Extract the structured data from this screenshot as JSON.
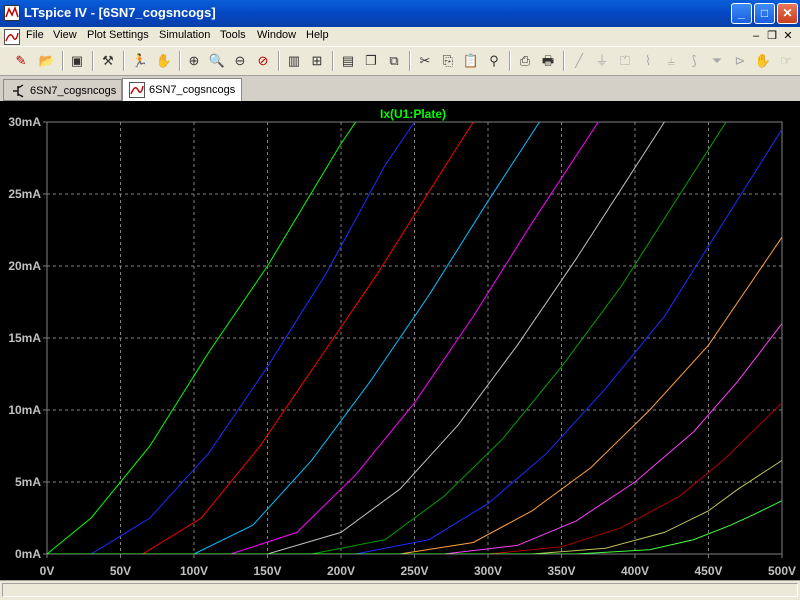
{
  "window": {
    "title": "LTspice IV - [6SN7_cogsncogs]",
    "controls": {
      "minimize": "_",
      "maximize": "□",
      "close": "✕"
    }
  },
  "menu": {
    "items": [
      "File",
      "View",
      "Plot Settings",
      "Simulation",
      "Tools",
      "Window",
      "Help"
    ],
    "mdi_controls": {
      "minimize": "–",
      "restore": "❐",
      "close": "✕"
    }
  },
  "toolbar": {
    "icons": [
      "new-schematic-icon",
      "open-icon",
      "save-icon",
      "control-panel-icon",
      "run-icon",
      "halt-icon",
      "zoom-in-icon",
      "zoom-area-icon",
      "zoom-out-icon",
      "zoom-cancel-icon",
      "autorange-icon",
      "zoom-extents-icon",
      "tile-icon",
      "cascade-icon",
      "close-windows-icon",
      "cut-icon",
      "copy-icon",
      "paste-icon",
      "find-icon",
      "print-setup-icon",
      "print-icon",
      "wire-icon",
      "ground-icon",
      "label-icon",
      "resistor-icon",
      "capacitor-icon",
      "inductor-icon",
      "diode-icon",
      "component-icon",
      "move-icon",
      "drag-icon"
    ]
  },
  "tabs": [
    {
      "label": "6SN7_cogsncogs",
      "icon": "schematic-icon",
      "active": false
    },
    {
      "label": "6SN7_cogsncogs",
      "icon": "waveform-icon",
      "active": true
    }
  ],
  "plot": {
    "trace_label": "Ix(U1:Plate)",
    "trace_label_color": "#00ff00",
    "grid_color": "#808080",
    "axis_text_color": "#c0c0c0"
  },
  "chart_data": {
    "type": "line",
    "title": "Ix(U1:Plate)",
    "xlabel": "",
    "ylabel": "",
    "xlim": [
      0,
      500
    ],
    "ylim": [
      0,
      30
    ],
    "x_ticks": [
      "0V",
      "50V",
      "100V",
      "150V",
      "200V",
      "250V",
      "300V",
      "350V",
      "400V",
      "450V",
      "500V"
    ],
    "y_ticks": [
      "0mA",
      "5mA",
      "10mA",
      "15mA",
      "20mA",
      "25mA",
      "30mA"
    ],
    "grid": true,
    "legend": "none",
    "series": [
      {
        "color": "#00ff00",
        "x": [
          0,
          30,
          70,
          110,
          150,
          200,
          210
        ],
        "y": [
          0,
          2.5,
          7.5,
          14,
          20,
          28.5,
          30
        ]
      },
      {
        "color": "#1c2cff",
        "x": [
          30,
          70,
          110,
          150,
          190,
          230,
          250
        ],
        "y": [
          0,
          2.5,
          7,
          13,
          19.5,
          27,
          30
        ]
      },
      {
        "color": "#ff0000",
        "x": [
          65,
          105,
          145,
          185,
          225,
          265,
          290
        ],
        "y": [
          0,
          2.5,
          7.5,
          13.5,
          19.5,
          26,
          30
        ]
      },
      {
        "color": "#00c0ff",
        "x": [
          100,
          140,
          180,
          220,
          260,
          300,
          335
        ],
        "y": [
          0,
          2,
          6.5,
          12,
          18,
          24.5,
          30
        ]
      },
      {
        "color": "#ff00ff",
        "x": [
          125,
          170,
          210,
          250,
          290,
          330,
          375
        ],
        "y": [
          0,
          1.5,
          5.5,
          10.5,
          16.5,
          23,
          30
        ]
      },
      {
        "color": "#c0c0c0",
        "x": [
          150,
          200,
          240,
          280,
          320,
          360,
          420
        ],
        "y": [
          0,
          1.5,
          4.5,
          9,
          14.5,
          20.5,
          30
        ]
      },
      {
        "color": "#00a000",
        "x": [
          180,
          230,
          270,
          310,
          350,
          390,
          462
        ],
        "y": [
          0,
          1,
          4,
          8,
          13,
          18.5,
          30
        ]
      },
      {
        "color": "#1c2cff",
        "x": [
          210,
          260,
          300,
          340,
          380,
          420,
          500
        ],
        "y": [
          0,
          1,
          3.5,
          7,
          11.5,
          16.5,
          29.5
        ]
      },
      {
        "color": "#ffa040",
        "x": [
          240,
          290,
          330,
          370,
          410,
          450,
          500
        ],
        "y": [
          0,
          0.8,
          3,
          6,
          10,
          14.5,
          22
        ]
      },
      {
        "color": "#ff40ff",
        "x": [
          270,
          320,
          360,
          400,
          440,
          470,
          500
        ],
        "y": [
          0,
          0.6,
          2.3,
          5,
          8.5,
          12,
          16
        ]
      },
      {
        "color": "#b00000",
        "x": [
          300,
          350,
          390,
          430,
          460,
          480,
          500
        ],
        "y": [
          0,
          0.5,
          1.8,
          4,
          6.5,
          8.5,
          10.5
        ]
      },
      {
        "color": "#c0c060",
        "x": [
          330,
          380,
          420,
          450,
          470,
          485,
          500
        ],
        "y": [
          0,
          0.4,
          1.5,
          3,
          4.5,
          5.5,
          6.5
        ]
      },
      {
        "color": "#40ff40",
        "x": [
          360,
          410,
          440,
          465,
          480,
          490,
          500
        ],
        "y": [
          0,
          0.3,
          1,
          2,
          2.7,
          3.2,
          3.7
        ]
      }
    ]
  }
}
